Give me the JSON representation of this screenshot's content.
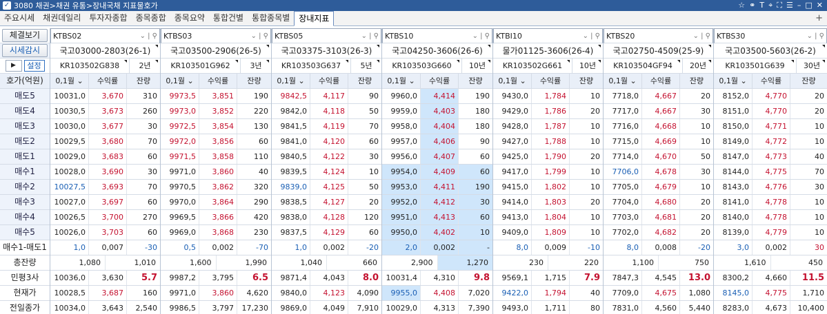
{
  "title": "3080 채권>채권 유통>장내국채 지표물호가",
  "tabs": [
    "주요시세",
    "채권데일리",
    "투자자종합",
    "종목종합",
    "종목요약",
    "통합건별",
    "통합종목별",
    "장내지표"
  ],
  "active_tab": 7,
  "labels": {
    "btn_settle": "체결보기",
    "btn_watch": "시세감시",
    "play": "▶",
    "setting": "설정",
    "hdr": "호가(억원)",
    "rows": [
      "매도5",
      "매도4",
      "매도3",
      "매도2",
      "매도1",
      "매수1",
      "매수2",
      "매수3",
      "매수4",
      "매수5",
      "매수1-매도1",
      "총잔량",
      "민평3사",
      "현재가",
      "전일종가"
    ]
  },
  "col_headers": {
    "unit": "0,1월",
    "yield": "수익률",
    "rem": "잔량"
  },
  "panels": [
    {
      "code": "KTBS02",
      "name": "국고03000-2803(26-1)",
      "isin": "KR103502G838",
      "mat": "2년",
      "rows": [
        [
          "10031,0",
          "3,670",
          "310"
        ],
        [
          "10030,5",
          "3,673",
          "260"
        ],
        [
          "10030,0",
          "3,677",
          "30"
        ],
        [
          "10029,5",
          "3,680",
          "70"
        ],
        [
          "10029,0",
          "3,683",
          "60"
        ],
        [
          "10028,0",
          "3,690",
          "30"
        ],
        [
          "10027,5",
          "3,693",
          "70"
        ],
        [
          "10027,0",
          "3,697",
          "60"
        ],
        [
          "10026,5",
          "3,700",
          "270"
        ],
        [
          "10026,0",
          "3,703",
          "60"
        ]
      ],
      "diff": [
        "1,0",
        "0,007",
        "-30"
      ],
      "total": [
        "1,080",
        "1,010"
      ],
      "minpyeong": [
        "10036,0",
        "3,630",
        "5.7"
      ],
      "cur": [
        "10028,5",
        "3,687",
        "160"
      ],
      "prev": [
        "10034,0",
        "3,643",
        "2,540"
      ]
    },
    {
      "code": "KTBS03",
      "name": "국고03500-2906(26-5)",
      "isin": "KR103501G962",
      "mat": "3년",
      "rows": [
        [
          "9973,5",
          "3,851",
          "190"
        ],
        [
          "9973,0",
          "3,852",
          "220"
        ],
        [
          "9972,5",
          "3,854",
          "130"
        ],
        [
          "9972,0",
          "3,856",
          "60"
        ],
        [
          "9971,5",
          "3,858",
          "110"
        ],
        [
          "9971,0",
          "3,860",
          "40"
        ],
        [
          "9970,5",
          "3,862",
          "320"
        ],
        [
          "9970,0",
          "3,864",
          "290"
        ],
        [
          "9969,5",
          "3,866",
          "420"
        ],
        [
          "9969,0",
          "3,868",
          "230"
        ]
      ],
      "diff": [
        "0,5",
        "0,002",
        "-70"
      ],
      "total": [
        "1,600",
        "1,990"
      ],
      "minpyeong": [
        "9987,2",
        "3,795",
        "6.5"
      ],
      "cur": [
        "9971,0",
        "3,860",
        "4,620"
      ],
      "prev": [
        "9986,5",
        "3,797",
        "17,230"
      ]
    },
    {
      "code": "KTBS05",
      "name": "국고03375-3103(26-3)",
      "isin": "KR103503G637",
      "mat": "5년",
      "rows": [
        [
          "9842,5",
          "4,117",
          "90"
        ],
        [
          "9842,0",
          "4,118",
          "50"
        ],
        [
          "9841,5",
          "4,119",
          "70"
        ],
        [
          "9841,0",
          "4,120",
          "60"
        ],
        [
          "9840,5",
          "4,122",
          "30"
        ],
        [
          "9839,5",
          "4,124",
          "10"
        ],
        [
          "9839,0",
          "4,125",
          "50"
        ],
        [
          "9838,5",
          "4,127",
          "20"
        ],
        [
          "9838,0",
          "4,128",
          "120"
        ],
        [
          "9837,5",
          "4,129",
          "60"
        ]
      ],
      "diff": [
        "1,0",
        "0,002",
        "-20"
      ],
      "total": [
        "1,040",
        "660"
      ],
      "minpyeong": [
        "9871,4",
        "4,043",
        "8.0"
      ],
      "cur": [
        "9840,0",
        "4,123",
        "4,090"
      ],
      "prev": [
        "9869,0",
        "4,049",
        "7,910"
      ]
    },
    {
      "code": "KTBS10",
      "name": "국고04250-3606(26-6)",
      "isin": "KR103503G660",
      "mat": "10년",
      "rows": [
        [
          "9960,0",
          "4,414",
          "190"
        ],
        [
          "9959,0",
          "4,403",
          "180"
        ],
        [
          "9958,0",
          "4,404",
          "180"
        ],
        [
          "9957,0",
          "4,406",
          "90"
        ],
        [
          "9956,0",
          "4,407",
          "60"
        ],
        [
          "9954,0",
          "4,409",
          "60"
        ],
        [
          "9953,0",
          "4,411",
          "190"
        ],
        [
          "9952,0",
          "4,412",
          "30"
        ],
        [
          "9951,0",
          "4,413",
          "60"
        ],
        [
          "9950,0",
          "4,402",
          "10"
        ]
      ],
      "diff": [
        "2,0",
        "0,002",
        "-"
      ],
      "total": [
        "2,900",
        "1,270"
      ],
      "minpyeong": [
        "10031,4",
        "4,310",
        "9.8"
      ],
      "cur": [
        "9955,0",
        "4,408",
        "7,020"
      ],
      "prev": [
        "10029,0",
        "4,313",
        "7,390"
      ]
    },
    {
      "code": "KTBI10",
      "name": "물가01125-3606(26-4)",
      "isin": "KR103502G661",
      "mat": "10년",
      "rows": [
        [
          "9430,0",
          "1,784",
          "10"
        ],
        [
          "9429,0",
          "1,786",
          "20"
        ],
        [
          "9428,0",
          "1,787",
          "10"
        ],
        [
          "9427,0",
          "1,788",
          "10"
        ],
        [
          "9425,0",
          "1,790",
          "20"
        ],
        [
          "9417,0",
          "1,799",
          "10"
        ],
        [
          "9415,0",
          "1,802",
          "10"
        ],
        [
          "9414,0",
          "1,803",
          "20"
        ],
        [
          "9413,0",
          "1,804",
          "10"
        ],
        [
          "9409,0",
          "1,809",
          "10"
        ]
      ],
      "diff": [
        "8,0",
        "0,009",
        "-10"
      ],
      "total": [
        "230",
        "220"
      ],
      "minpyeong": [
        "9569,1",
        "1,715",
        "7.9"
      ],
      "cur": [
        "9422,0",
        "1,794",
        "40"
      ],
      "prev": [
        "9493,0",
        "1,711",
        "80"
      ]
    },
    {
      "code": "KTBS20",
      "name": "국고02750-4509(25-9)",
      "isin": "KR103504GF94",
      "mat": "20년",
      "rows": [
        [
          "7718,0",
          "4,667",
          "20"
        ],
        [
          "7717,0",
          "4,667",
          "30"
        ],
        [
          "7716,0",
          "4,668",
          "10"
        ],
        [
          "7715,0",
          "4,669",
          "10"
        ],
        [
          "7714,0",
          "4,670",
          "50"
        ],
        [
          "7706,0",
          "4,678",
          "30"
        ],
        [
          "7705,0",
          "4,679",
          "10"
        ],
        [
          "7704,0",
          "4,680",
          "20"
        ],
        [
          "7703,0",
          "4,681",
          "20"
        ],
        [
          "7702,0",
          "4,682",
          "20"
        ]
      ],
      "diff": [
        "8,0",
        "0,008",
        "-20"
      ],
      "total": [
        "1,100",
        "750"
      ],
      "minpyeong": [
        "7847,3",
        "4,545",
        "13.0"
      ],
      "cur": [
        "7709,0",
        "4,675",
        "1,080"
      ],
      "prev": [
        "7831,0",
        "4,560",
        "5,440"
      ]
    },
    {
      "code": "KTBS30",
      "name": "국고03500-5603(26-2)",
      "isin": "KR103501G639",
      "mat": "30년",
      "rows": [
        [
          "8152,0",
          "4,770",
          "20"
        ],
        [
          "8151,0",
          "4,770",
          "20"
        ],
        [
          "8150,0",
          "4,771",
          "10"
        ],
        [
          "8149,0",
          "4,772",
          "10"
        ],
        [
          "8147,0",
          "4,773",
          "40"
        ],
        [
          "8144,0",
          "4,775",
          "70"
        ],
        [
          "8143,0",
          "4,776",
          "30"
        ],
        [
          "8141,0",
          "4,778",
          "10"
        ],
        [
          "8140,0",
          "4,778",
          "10"
        ],
        [
          "8139,0",
          "4,779",
          "10"
        ]
      ],
      "diff": [
        "3,0",
        "0,002",
        "30"
      ],
      "total": [
        "1,610",
        "450"
      ],
      "minpyeong": [
        "8300,2",
        "4,660",
        "11.5"
      ],
      "cur": [
        "8145,0",
        "4,775",
        "1,710"
      ],
      "prev": [
        "8283,0",
        "4,673",
        "10,400"
      ]
    }
  ],
  "colors": {
    "accent": "#2e5c9a",
    "highlight": "#cfe6fb",
    "red": "#c41230",
    "blue": "#1a5fb4"
  }
}
